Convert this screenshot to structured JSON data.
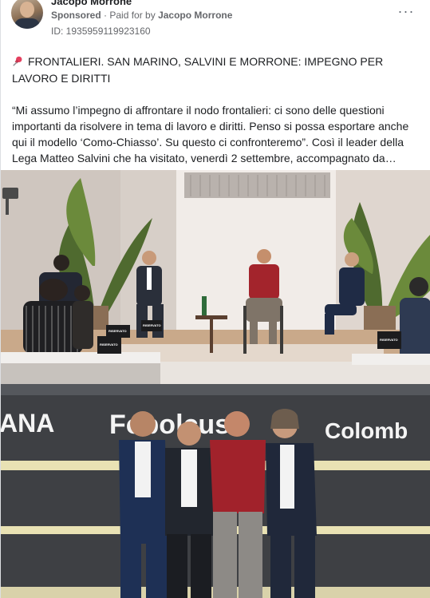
{
  "post": {
    "author": "Jacopo Morrone",
    "sponsored_label": "Sponsored",
    "paid_prefix": "· Paid for by",
    "paid_by": "Jacopo Morrone",
    "id_line": "ID: 1935959119923160",
    "more_symbol": "···",
    "headline": "FRONTALIERI. SAN MARINO, SALVINI E MORRONE: IMPEGNO PER LAVORO E DIRITTI",
    "body": "“Mi assumo l’impegno di affrontare il nodo frontalieri: ci sono delle questioni importanti da risolvere in tema di lavoro e diritti. Penso si possa esportare anche qui il modello ‘Como-Chiasso’. Su questo ci confronteremo”. Così il leader della Lega Matteo Salvini che ha visitato, venerdì 2 settembre, accompagnato da…"
  },
  "photo1": {
    "placards": [
      "RISERVATO",
      "RISERVATO",
      "RISERVATO",
      "RISERVATO"
    ]
  },
  "photo2": {
    "wall_left_text": "ANA",
    "wall_mid_text": "Fobolcus",
    "wall_right_text": "Colomb"
  },
  "colors": {
    "text": "#1c1e21",
    "secondary": "#65676b",
    "pin": "#e4405f"
  },
  "icons": {
    "pin": "pushpin-icon",
    "more": "more-options-icon"
  }
}
